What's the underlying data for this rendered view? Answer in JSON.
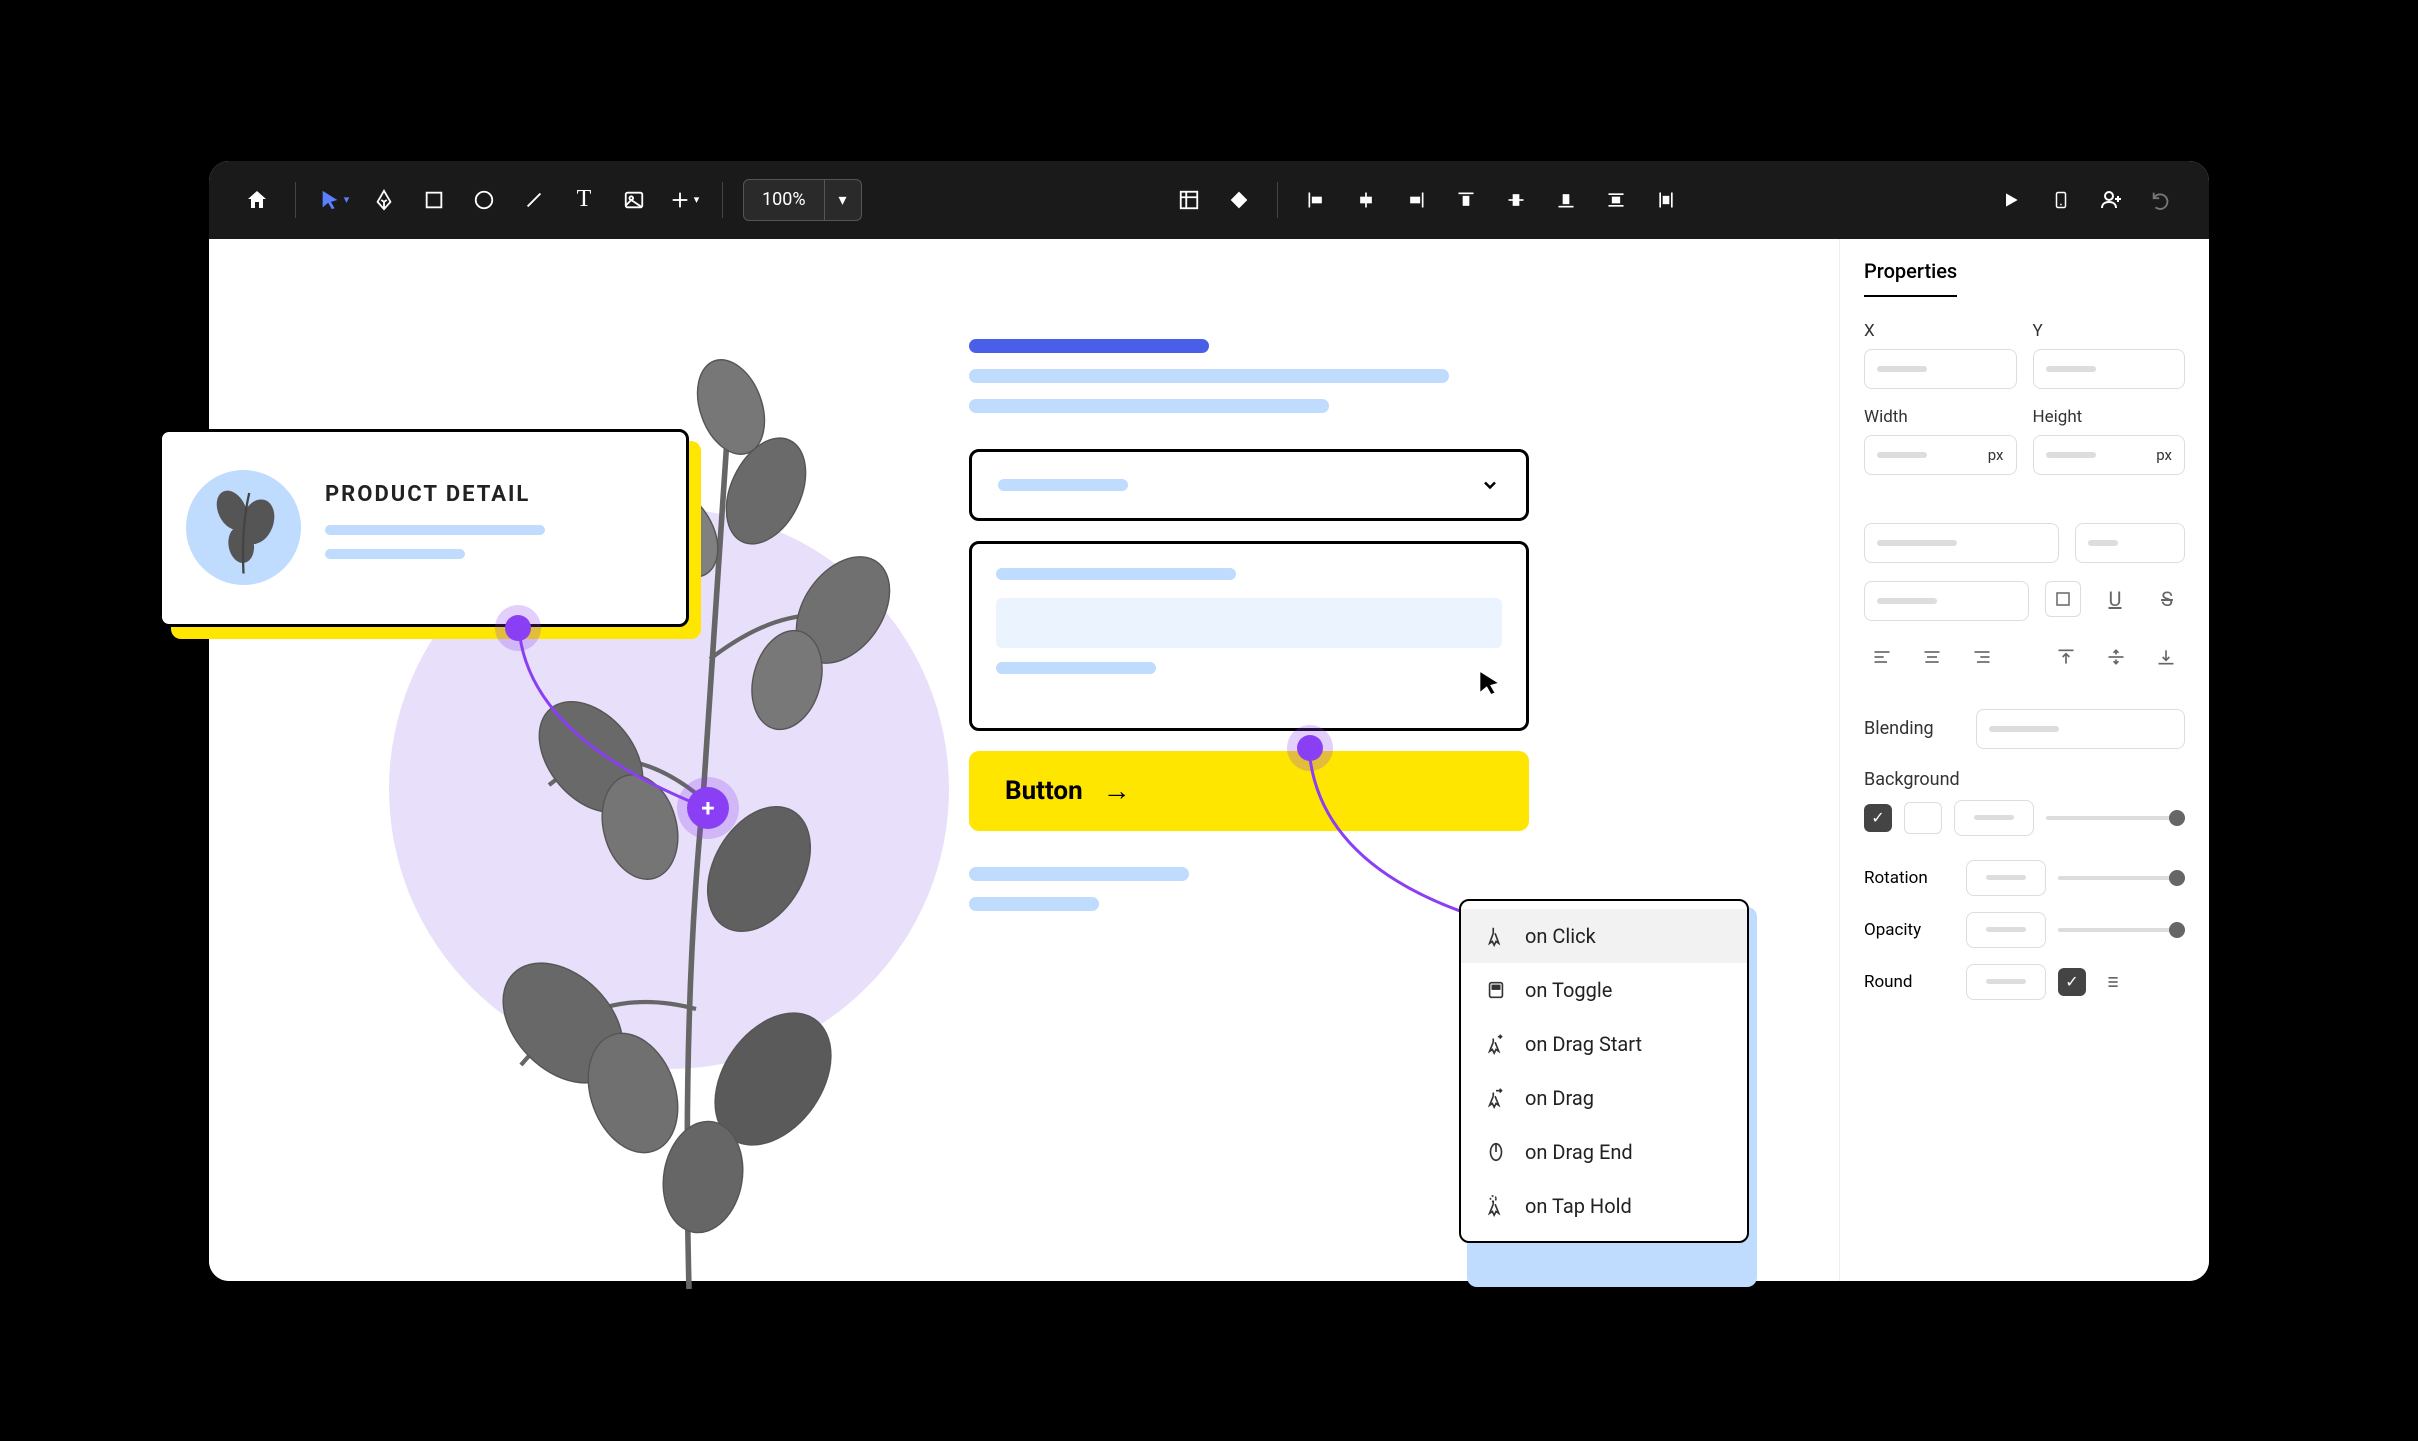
{
  "toolbar": {
    "zoom": "100%",
    "icons": {
      "home": "home-icon",
      "select": "pointer-icon",
      "pen": "pen-icon",
      "rect": "rectangle-icon",
      "circle": "ellipse-icon",
      "line": "line-icon",
      "text": "text-icon",
      "image": "image-icon",
      "add": "plus-icon",
      "grid": "layout-grid-icon",
      "diamond": "color-icon",
      "align_left": "align-left-icon",
      "align_h": "align-center-h-icon",
      "align_right": "align-right-icon",
      "align_top": "align-top-icon",
      "align_v": "align-center-v-icon",
      "align_bottom": "align-bottom-icon",
      "dist_v": "distribute-v-icon",
      "dist_h": "distribute-h-icon",
      "play": "play-icon",
      "device": "device-icon",
      "share": "add-user-icon",
      "undo": "undo-icon"
    }
  },
  "panel": {
    "tab": "Properties",
    "x_label": "X",
    "y_label": "Y",
    "width_label": "Width",
    "height_label": "Height",
    "unit": "px",
    "blending_label": "Blending",
    "background_label": "Background",
    "rotation_label": "Rotation",
    "opacity_label": "Opacity",
    "round_label": "Round",
    "underline": "U",
    "strike": "S"
  },
  "card": {
    "title": "PRODUCT DETAIL"
  },
  "form": {
    "button_label": "Button"
  },
  "events": {
    "items": [
      {
        "label": "on Click",
        "icon": "click-icon"
      },
      {
        "label": "on Toggle",
        "icon": "toggle-icon"
      },
      {
        "label": "on Drag Start",
        "icon": "drag-start-icon"
      },
      {
        "label": "on Drag",
        "icon": "drag-icon"
      },
      {
        "label": "on Drag End",
        "icon": "drag-end-icon"
      },
      {
        "label": "on Tap Hold",
        "icon": "tap-hold-icon"
      }
    ]
  }
}
